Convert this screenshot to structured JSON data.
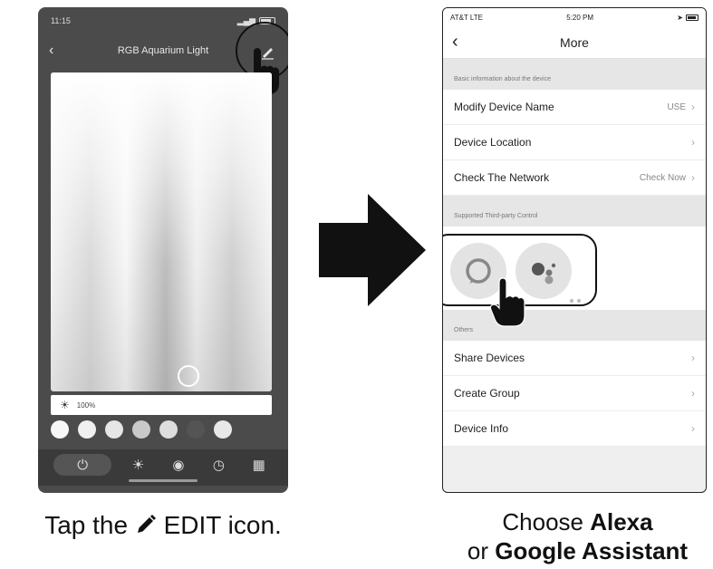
{
  "left_phone": {
    "status_time": "11:15",
    "title": "RGB Aquarium Light",
    "back_icon": "chevron-left-icon",
    "edit_icon": "pencil-icon",
    "brightness": "100%",
    "swatch_colors": [
      "#f7f7f7",
      "#f0f0f0",
      "#e6e6e6",
      "#c9c9c9",
      "#dedede",
      "#545454",
      "#e8e8e8"
    ],
    "tabs": [
      {
        "name": "tab-power",
        "icon": "power-icon",
        "glyph": "⏻"
      },
      {
        "name": "tab-white",
        "icon": "sun-icon",
        "glyph": "☀"
      },
      {
        "name": "tab-scene",
        "icon": "eye-icon",
        "glyph": "◉"
      },
      {
        "name": "tab-schedule",
        "icon": "clock-icon",
        "glyph": "◷"
      },
      {
        "name": "tab-more",
        "icon": "grid-icon",
        "glyph": "▦"
      }
    ]
  },
  "caption_left": {
    "before": "Tap the",
    "after": " EDIT icon."
  },
  "right_phone": {
    "status_carrier": "AT&T  LTE",
    "status_time": "5:20 PM",
    "title": "More",
    "section_basic": "Basic information about the device",
    "rows_basic": [
      {
        "label": "Modify Device Name",
        "value": "USE"
      },
      {
        "label": "Device Location",
        "value": ""
      },
      {
        "label": "Check The Network",
        "value": "Check Now"
      }
    ],
    "section_third_party": "Supported Third-party Control",
    "section_others": "Others",
    "rows_others": [
      {
        "label": "Share Devices"
      },
      {
        "label": "Create Group"
      },
      {
        "label": "Device Info"
      }
    ]
  },
  "caption_right": {
    "line1_pre": "Choose ",
    "line1_bold": "Alexa",
    "line2_pre": "or ",
    "line2_bold": "Google Assistant"
  }
}
